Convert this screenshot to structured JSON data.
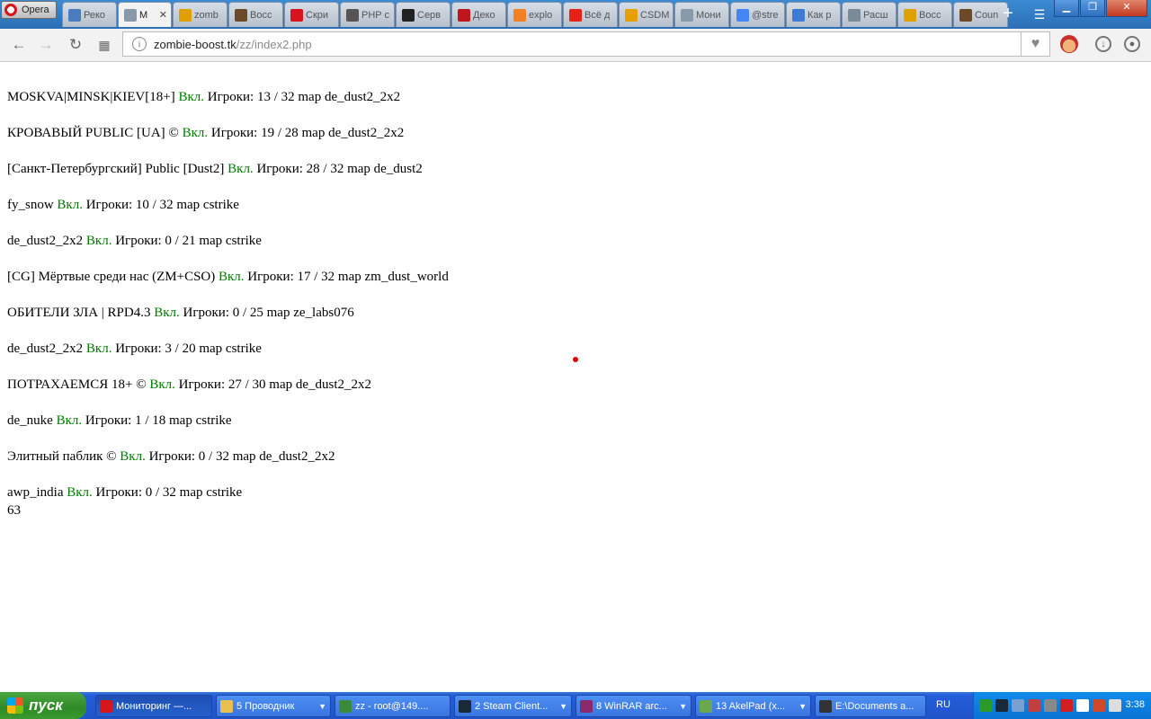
{
  "browser": {
    "menu_label": "Opera",
    "tabs": [
      {
        "label": "Реко",
        "icon": "video-tab-icon",
        "color": "#4a7dbf",
        "active": false
      },
      {
        "label": "М",
        "icon": "page-tab-icon",
        "color": "#8899aa",
        "active": true
      },
      {
        "label": "zomb",
        "icon": "rma-tab-icon",
        "color": "#e0a000",
        "active": false
      },
      {
        "label": "Восс",
        "icon": "cs-tab-icon",
        "color": "#6b4a2a",
        "active": false
      },
      {
        "label": "Скри",
        "icon": "opera-tab-icon",
        "color": "#d8141c",
        "active": false
      },
      {
        "label": "PHP с",
        "icon": "php-tab-icon",
        "color": "#555555",
        "active": false
      },
      {
        "label": "Серв",
        "icon": "cs-logo-tab-icon",
        "color": "#222222",
        "active": false
      },
      {
        "label": "Деко",
        "icon": "tab-icon-red",
        "color": "#c0151b",
        "active": false
      },
      {
        "label": "explo",
        "icon": "stackoverflow-tab-icon",
        "color": "#f48024",
        "active": false
      },
      {
        "label": "Всё д",
        "icon": "youtube-tab-icon",
        "color": "#e62117",
        "active": false
      },
      {
        "label": "CSDM",
        "icon": "csdm-tab-icon",
        "color": "#e8a000",
        "active": false
      },
      {
        "label": "Мони",
        "icon": "page-tab-icon",
        "color": "#8899aa",
        "active": false
      },
      {
        "label": "@stre",
        "icon": "google-tab-icon",
        "color": "#4285f4",
        "active": false
      },
      {
        "label": "Как р",
        "icon": "network-tab-icon",
        "color": "#3c7ad6",
        "active": false
      },
      {
        "label": "Расш",
        "icon": "puzzle-tab-icon",
        "color": "#7a8a99",
        "active": false
      },
      {
        "label": "Восс",
        "icon": "target-tab-icon",
        "color": "#e0a000",
        "active": false
      },
      {
        "label": "Coun",
        "icon": "cs-tab-icon",
        "color": "#6b4a2a",
        "active": false
      }
    ],
    "tab_close": "✕",
    "new_tab": "+",
    "url_host": "zombie-boost.tk",
    "url_path": "/zz/index2.php"
  },
  "page": {
    "servers": [
      {
        "name": "MOSKVA|MINSK|KIEV[18+]",
        "status": "Вкл.",
        "info": "Игроки: 13 / 32 map de_dust2_2x2"
      },
      {
        "name": "КРОВАВЫЙ PUBLIC [UA] ©",
        "status": "Вкл.",
        "info": "Игроки: 19 / 28 map de_dust2_2x2"
      },
      {
        "name": "[Санкт-Петербургский] Public [Dust2]",
        "status": "Вкл.",
        "info": "Игроки: 28 / 32 map de_dust2"
      },
      {
        "name": "fy_snow",
        "status": "Вкл.",
        "info": "Игроки: 10 / 32 map cstrike"
      },
      {
        "name": "de_dust2_2x2",
        "status": "Вкл.",
        "info": "Игроки: 0 / 21 map cstrike"
      },
      {
        "name": "[CG] Мёртвые среди нас (ZM+CSO)",
        "status": "Вкл.",
        "info": "Игроки: 17 / 32 map zm_dust_world"
      },
      {
        "name": "ОБИТЕЛИ ЗЛА | RPD4.3",
        "status": "Вкл.",
        "info": "Игроки: 0 / 25 map ze_labs076"
      },
      {
        "name": "de_dust2_2x2",
        "status": "Вкл.",
        "info": "Игроки: 3 / 20 map cstrike"
      },
      {
        "name": "ПОТРАХАЕМСЯ 18+ ©",
        "status": "Вкл.",
        "info": "Игроки: 27 / 30 map de_dust2_2x2"
      },
      {
        "name": "de_nuke",
        "status": "Вкл.",
        "info": "Игроки: 1 / 18 map cstrike"
      },
      {
        "name": "Элитный паблик ©",
        "status": "Вкл.",
        "info": "Игроки: 0 / 32 map de_dust2_2x2"
      },
      {
        "name": "awp_india",
        "status": "Вкл.",
        "info": "Игроки: 0 / 32 map cstrike"
      }
    ],
    "total": "63",
    "status_color": "#007b00"
  },
  "taskbar": {
    "start_label": "пуск",
    "tasks": [
      {
        "label": "Мониторинг —...",
        "icon": "opera-icon",
        "color": "#d8141c",
        "arrow": false,
        "active": true
      },
      {
        "label": "5 Проводник",
        "icon": "folder-icon",
        "color": "#e8c050",
        "arrow": true,
        "active": false
      },
      {
        "label": "zz - root@149....",
        "icon": "ftp-icon",
        "color": "#3a8a3a",
        "arrow": false,
        "active": false
      },
      {
        "label": "2 Steam Client...",
        "icon": "steam-icon",
        "color": "#1b2838",
        "arrow": true,
        "active": false
      },
      {
        "label": "8 WinRAR arc...",
        "icon": "winrar-icon",
        "color": "#8a2a6a",
        "arrow": true,
        "active": false
      },
      {
        "label": "13 AkelPad (x...",
        "icon": "notepad-icon",
        "color": "#6aa84f",
        "arrow": true,
        "active": false
      },
      {
        "label": "E:\\Documents a...",
        "icon": "console-icon",
        "color": "#333333",
        "arrow": false,
        "active": false
      }
    ],
    "lang": "RU",
    "clock": "3:38"
  }
}
